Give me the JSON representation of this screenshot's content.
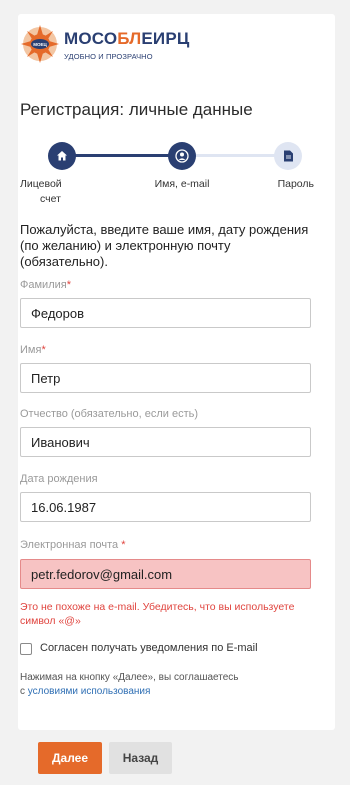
{
  "brand": {
    "name_a": "МОСО",
    "name_b": "БЛ",
    "name_c": "ЕИРЦ",
    "tagline": "УДОБНО И ПРОЗРАЧНО",
    "badge": "МОЕЦ"
  },
  "page_title": "Регистрация: личные данные",
  "stepper": {
    "steps": [
      {
        "label_line1": "Лицевой",
        "label_line2": "счет",
        "icon": "home-icon",
        "state": "done"
      },
      {
        "label_line1": "Имя, e-mail",
        "label_line2": "",
        "icon": "user-icon",
        "state": "active"
      },
      {
        "label_line1": "Пароль",
        "label_line2": "",
        "icon": "document-icon",
        "state": "todo"
      }
    ]
  },
  "intro": "Пожалуйста, введите ваше имя, дату рождения (по желанию) и электронную почту (обязательно).",
  "form": {
    "last_name": {
      "label": "Фамилия",
      "required": "*",
      "value": "Федоров"
    },
    "first_name": {
      "label": "Имя",
      "required": "*",
      "value": "Петр"
    },
    "middle_name": {
      "label": "Отчество (обязательно, если есть)",
      "value": "Иванович"
    },
    "birth_date": {
      "label": "Дата рождения",
      "value": "16.06.1987"
    },
    "email": {
      "label": "Электронная почта ",
      "required": "*",
      "value": "petr.fedorov@gmail.com",
      "error": "Это не похоже на e-mail. Убедитесь, что вы используете символ «@»"
    },
    "notify": {
      "label": "Согласен получать уведомления по E-mail",
      "checked": false
    }
  },
  "terms": {
    "text": "Нажимая на кнопку «Далее», вы соглашаетесь",
    "prefix": "с ",
    "link": "условиями использования"
  },
  "buttons": {
    "next": "Далее",
    "back": "Назад"
  },
  "colors": {
    "brand_navy": "#2a3f72",
    "brand_orange": "#e56a2a",
    "error": "#e0443e",
    "error_bg": "#f7c3c3"
  }
}
